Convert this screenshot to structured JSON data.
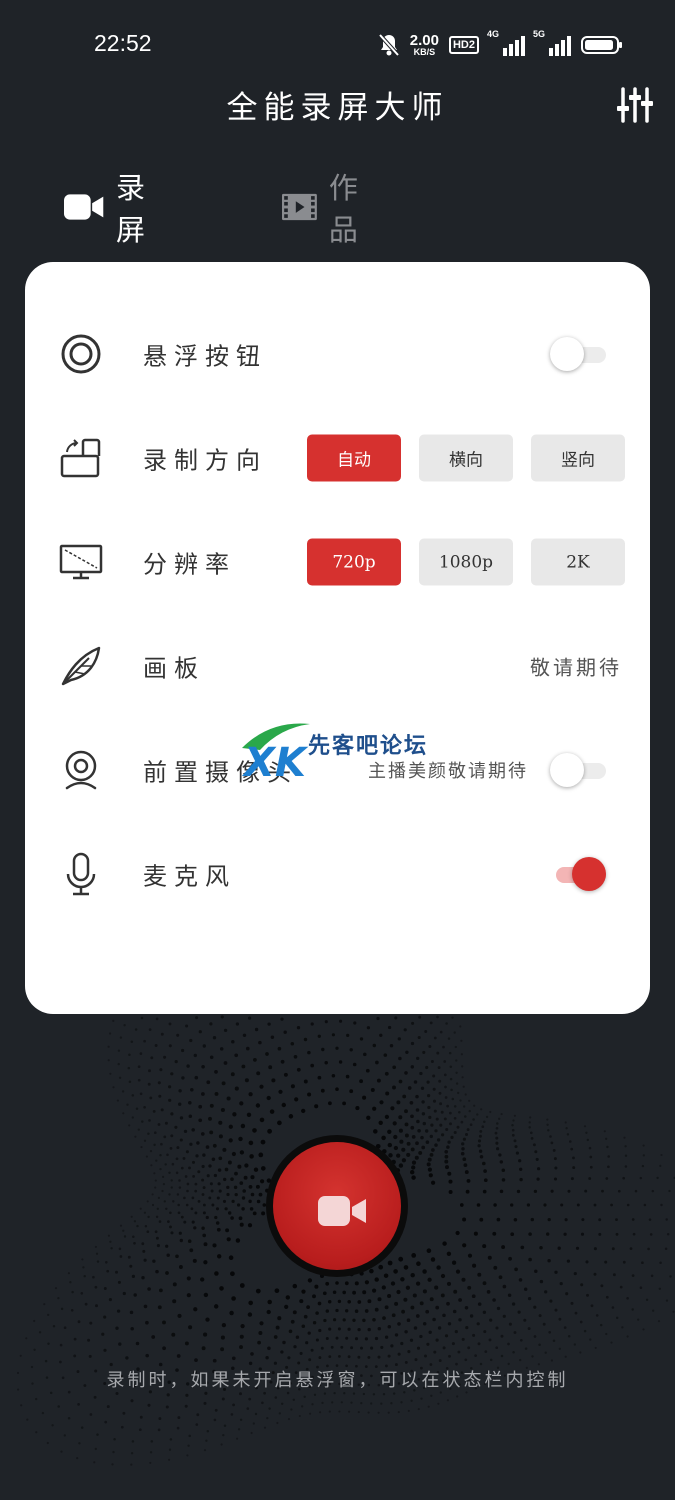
{
  "status_bar": {
    "time": "22:52",
    "speed_value": "2.00",
    "speed_unit": "KB/S",
    "hd_label": "HD2",
    "network_1": "4G",
    "network_2": "5G",
    "icons": [
      "bell-muted-icon",
      "hd-voice-icon",
      "signal-4g-icon",
      "signal-5g-icon",
      "battery-icon"
    ]
  },
  "header": {
    "title": "全能录屏大师",
    "settings_icon": "sliders-icon"
  },
  "tabs": [
    {
      "label": "录屏",
      "icon": "video-camera-icon",
      "active": true
    },
    {
      "label": "作品",
      "icon": "film-strip-icon",
      "active": false
    }
  ],
  "settings": {
    "floating_button": {
      "label": "悬浮按钮",
      "icon": "circle-target-icon",
      "enabled": false
    },
    "orientation": {
      "label": "录制方向",
      "icon": "rotate-screen-icon",
      "options": [
        "自动",
        "横向",
        "竖向"
      ],
      "selected": "自动"
    },
    "resolution": {
      "label": "分辨率",
      "icon": "monitor-icon",
      "options": [
        "720p",
        "1080p",
        "2K"
      ],
      "selected": "720p"
    },
    "drawing_board": {
      "label": "画板",
      "icon": "feather-icon",
      "status": "敬请期待"
    },
    "front_camera": {
      "label": "前置摄像头",
      "icon": "webcam-icon",
      "status": "主播美颜敬请期待",
      "enabled": false
    },
    "microphone": {
      "label": "麦克风",
      "icon": "microphone-icon",
      "enabled": true
    }
  },
  "watermark": {
    "text": "先客吧论坛",
    "logo": "XK"
  },
  "record": {
    "icon": "video-camera-icon",
    "hint": "录制时，如果未开启悬浮窗，可以在状态栏内控制"
  },
  "colors": {
    "accent": "#d6312f",
    "background": "#1f2328",
    "card": "#ffffff"
  }
}
